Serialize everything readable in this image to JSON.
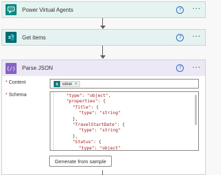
{
  "steps": [
    {
      "title": "Power Virtual Agents",
      "icon": "chat-bot-icon",
      "color": "#0b8a80"
    },
    {
      "title": "Get items",
      "icon": "sharepoint-icon",
      "color": "#036c70"
    },
    {
      "title": "Parse JSON",
      "icon": "curly-braces-icon",
      "color": "#8661c5"
    }
  ],
  "info_glyph": "?",
  "more_glyph": "···",
  "parse_json": {
    "content_label": "Content",
    "content_required": "*",
    "schema_label": "Schema",
    "schema_required": "*",
    "content_token": {
      "label": "value",
      "close": "×",
      "color": "#0b7a75"
    },
    "schema_lines": [
      {
        "indent": 1,
        "key": "\"type\"",
        "rest": ": ",
        "val": "\"object\"",
        "tail": ","
      },
      {
        "indent": 1,
        "key": "\"properties\"",
        "rest": ": {",
        "val": "",
        "tail": ""
      },
      {
        "indent": 2,
        "key": "\"Title\"",
        "rest": ": {",
        "val": "",
        "tail": ""
      },
      {
        "indent": 3,
        "key": "\"type\"",
        "rest": ": ",
        "val": "\"string\"",
        "tail": ""
      },
      {
        "indent": 2,
        "key": "",
        "rest": "},",
        "val": "",
        "tail": ""
      },
      {
        "indent": 2,
        "key": "\"TravelStartDate\"",
        "rest": ": {",
        "val": "",
        "tail": ""
      },
      {
        "indent": 3,
        "key": "\"type\"",
        "rest": ": ",
        "val": "\"string\"",
        "tail": ""
      },
      {
        "indent": 2,
        "key": "",
        "rest": "},",
        "val": "",
        "tail": ""
      },
      {
        "indent": 2,
        "key": "\"Status\"",
        "rest": ": {",
        "val": "",
        "tail": ""
      },
      {
        "indent": 3,
        "key": "\"type\"",
        "rest": ": ",
        "val": "\"object\"",
        "tail": ""
      }
    ],
    "generate_button": "Generate from sample"
  }
}
